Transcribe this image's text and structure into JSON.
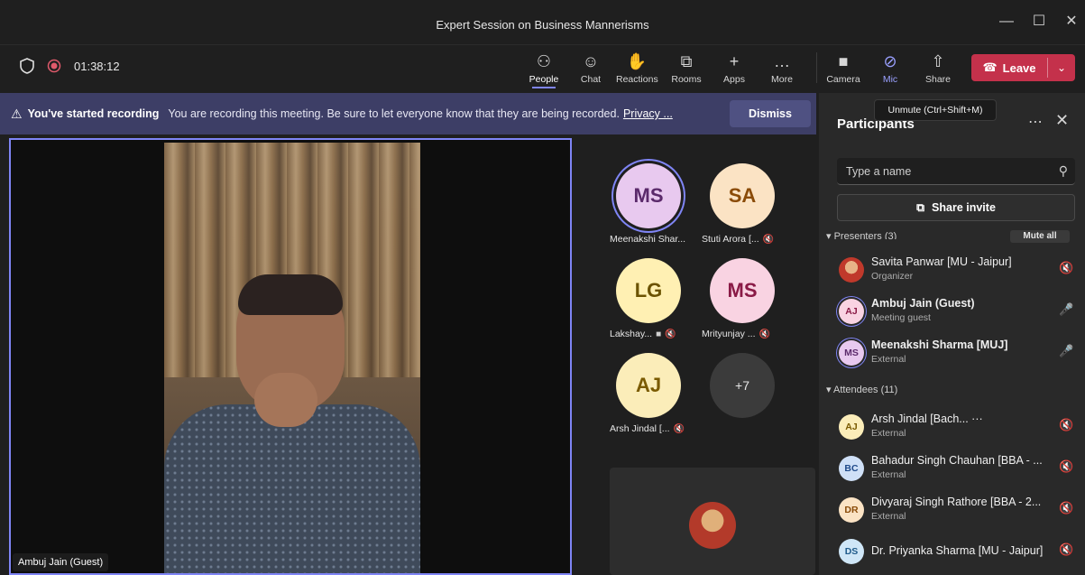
{
  "window": {
    "title": "Expert Session on Business Mannerisms",
    "minimize": "—",
    "maximize": "☐",
    "close": "✕"
  },
  "toolbar": {
    "timer": "01:38:12",
    "buttons": [
      {
        "label": "People",
        "icon": "people-icon",
        "glyph": "⚇"
      },
      {
        "label": "Chat",
        "icon": "chat-icon",
        "glyph": "☺"
      },
      {
        "label": "Reactions",
        "icon": "reactions-icon",
        "glyph": "✋"
      },
      {
        "label": "Rooms",
        "icon": "rooms-icon",
        "glyph": "⧉"
      },
      {
        "label": "Apps",
        "icon": "apps-icon",
        "glyph": "+"
      },
      {
        "label": "More",
        "icon": "more-icon",
        "glyph": "…"
      },
      {
        "label": "Camera",
        "icon": "camera-off-icon",
        "glyph": "■"
      },
      {
        "label": "Mic",
        "icon": "mic-off-icon",
        "glyph": "⊘"
      },
      {
        "label": "Share",
        "icon": "share-icon",
        "glyph": "⇧"
      }
    ],
    "leave_label": "Leave",
    "leave_color": "#c4314b"
  },
  "tooltip": "Unmute (Ctrl+Shift+M)",
  "banner": {
    "title": "You've started recording",
    "message": "You are recording this meeting. Be sure to let everyone know that they are being recorded.",
    "link": "Privacy ...",
    "dismiss": "Dismiss"
  },
  "main_video": {
    "name": "Ambuj Jain (Guest)"
  },
  "gallery": [
    {
      "initials": "MS",
      "name": "Meenakshi Shar...",
      "muted": false,
      "bg": "#e8c9ef",
      "fg": "#5b2a6b",
      "ring": true
    },
    {
      "initials": "SA",
      "name": "Stuti Arora [...",
      "muted": true,
      "bg": "#fbe3c4",
      "fg": "#8a4b08",
      "ring": false
    },
    {
      "initials": "LG",
      "name": "Lakshay...",
      "muted": true,
      "bg": "#fff0b3",
      "fg": "#6b5200",
      "ring": false
    },
    {
      "initials": "MS",
      "name": "Mrityunjay ...",
      "muted": true,
      "bg": "#f9d3e2",
      "fg": "#8a1a46",
      "ring": false
    },
    {
      "initials": "AJ",
      "name": "Arsh Jindal [...",
      "muted": true,
      "bg": "#fbedb9",
      "fg": "#7a5a00",
      "ring": false
    },
    {
      "initials": "+7",
      "name": "",
      "muted": false,
      "bg": "#3b3b3b",
      "fg": "#e6e6e6",
      "ring": false
    }
  ],
  "panel": {
    "title": "Participants",
    "search_placeholder": "Type a name",
    "share_invite": "Share invite",
    "presenters_header": "Presenters (3)",
    "mute_all": "Mute all",
    "attendees_header": "Attendees (11)",
    "presenters": [
      {
        "initials": "",
        "name": "Savita Panwar [MU - Jaipur]",
        "role": "Organizer",
        "bold": false,
        "mic": "off",
        "bg": "#c47b3c",
        "fg": "#ffffff"
      },
      {
        "initials": "AJ",
        "name": "Ambuj Jain (Guest)",
        "role": "Meeting guest",
        "bold": true,
        "mic": "on",
        "bg": "#f9d3e2",
        "fg": "#8a1a46"
      },
      {
        "initials": "MS",
        "name": "Meenakshi Sharma [MUJ]",
        "role": "External",
        "bold": true,
        "mic": "on",
        "bg": "#e8c9ef",
        "fg": "#5b2a6b"
      }
    ],
    "attendees": [
      {
        "initials": "AJ",
        "name": "Arsh Jindal [Bach... ···",
        "role": "External",
        "bold": false,
        "mic": "off",
        "bg": "#fbedb9",
        "fg": "#7a5a00"
      },
      {
        "initials": "BC",
        "name": "Bahadur Singh Chauhan [BBA - ...",
        "role": "External",
        "bold": false,
        "mic": "off",
        "bg": "#cfe0f7",
        "fg": "#1f4a8a"
      },
      {
        "initials": "DR",
        "name": "Divyaraj Singh Rathore [BBA - 2...",
        "role": "External",
        "bold": false,
        "mic": "off",
        "bg": "#fbe3c4",
        "fg": "#8a4b08"
      },
      {
        "initials": "DS",
        "name": "Dr. Priyanka Sharma [MU - Jaipur]",
        "role": "",
        "bold": false,
        "mic": "off",
        "bg": "#cfe6f7",
        "fg": "#1f5a8a"
      }
    ]
  },
  "accent": "#7f85f5"
}
